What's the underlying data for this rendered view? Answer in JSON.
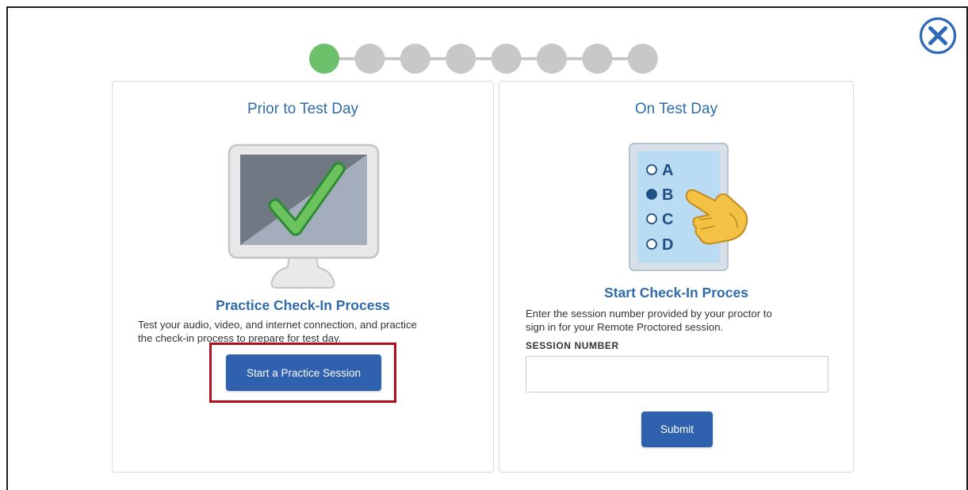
{
  "progress": {
    "total_steps": 8,
    "current_step": 1,
    "active_color": "#6cc06a",
    "inactive_color": "#c8c8c8"
  },
  "close": {
    "icon": "close-circle-icon",
    "color": "#2e69b8"
  },
  "prior": {
    "title": "Prior to Test Day",
    "heading": "Practice Check-In Process",
    "description_line1": "Test your audio, video, and internet connection, and practice",
    "description_line2": "the check-in process to prepare for test day.",
    "button_label": "Start a Practice Session",
    "illustration_icon": "monitor-checkmark-icon"
  },
  "on_test_day": {
    "title": "On Test Day",
    "heading": "Start Check-In Proces",
    "description_line1": "Enter the session number provided by your proctor to",
    "description_line2": "sign in for your Remote Proctored session.",
    "field_label": "SESSION NUMBER",
    "session_value": "",
    "session_placeholder": "",
    "submit_label": "Submit",
    "illustration_icon": "tablet-multiple-choice-icon",
    "choices": [
      "A",
      "B",
      "C",
      "D"
    ],
    "selected_choice": "B"
  },
  "colors": {
    "title": "#2f6da8",
    "heading": "#2f6aae",
    "button": "#2f61ae",
    "highlight": "#b00e1d"
  }
}
